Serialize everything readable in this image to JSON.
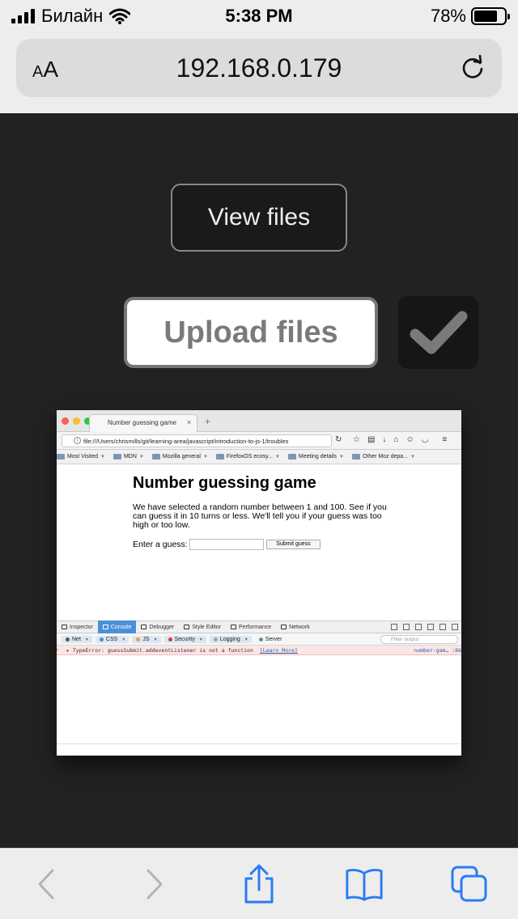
{
  "status_bar": {
    "carrier": "Билайн",
    "time": "5:38 PM",
    "battery": "78%",
    "battery_level": 0.78
  },
  "address_bar": {
    "text_size_label_small": "A",
    "text_size_label_large": "A",
    "url": "192.168.0.179"
  },
  "page": {
    "view_files_label": "View files",
    "upload_files_label": "Upload files"
  },
  "thumbnail": {
    "tab_title": "Number guessing game",
    "url": "file:///Users/chrismills/git/learning-area/javascript/introduction-to-js-1/troubles",
    "bookmarks": [
      "Most Visited",
      "MDN",
      "Mozilla general",
      "FirefoxOS ecosy...",
      "Meeting details",
      "Other Moz depa..."
    ],
    "heading": "Number guessing game",
    "intro": "We have selected a random number between 1 and 100. See if you can guess it in 10 turns or less. We'll tell you if your guess was too high or too low.",
    "guess_label": "Enter a guess:",
    "submit_label": "Submit guess",
    "devtools_tabs": [
      "Inspector",
      "Console",
      "Debugger",
      "Style Editor",
      "Performance",
      "Network"
    ],
    "active_devtools_tab": "Console",
    "filters": [
      "Net",
      "CSS",
      "JS",
      "Security",
      "Logging",
      "Server"
    ],
    "filter_placeholder": "Filter output",
    "error_message": "TypeError: guessSubmit.addeventListener is not a function",
    "learn_more": "[Learn More]",
    "error_source": "number-gam… :86"
  },
  "bottom_toolbar": {
    "buttons": [
      "back",
      "forward",
      "share",
      "bookmarks",
      "tabs"
    ]
  },
  "colors": {
    "background": "#222222",
    "ios_blue": "#2a7bf5",
    "devtools_active": "#4a90d9",
    "error_bg": "#fbe5e5"
  }
}
